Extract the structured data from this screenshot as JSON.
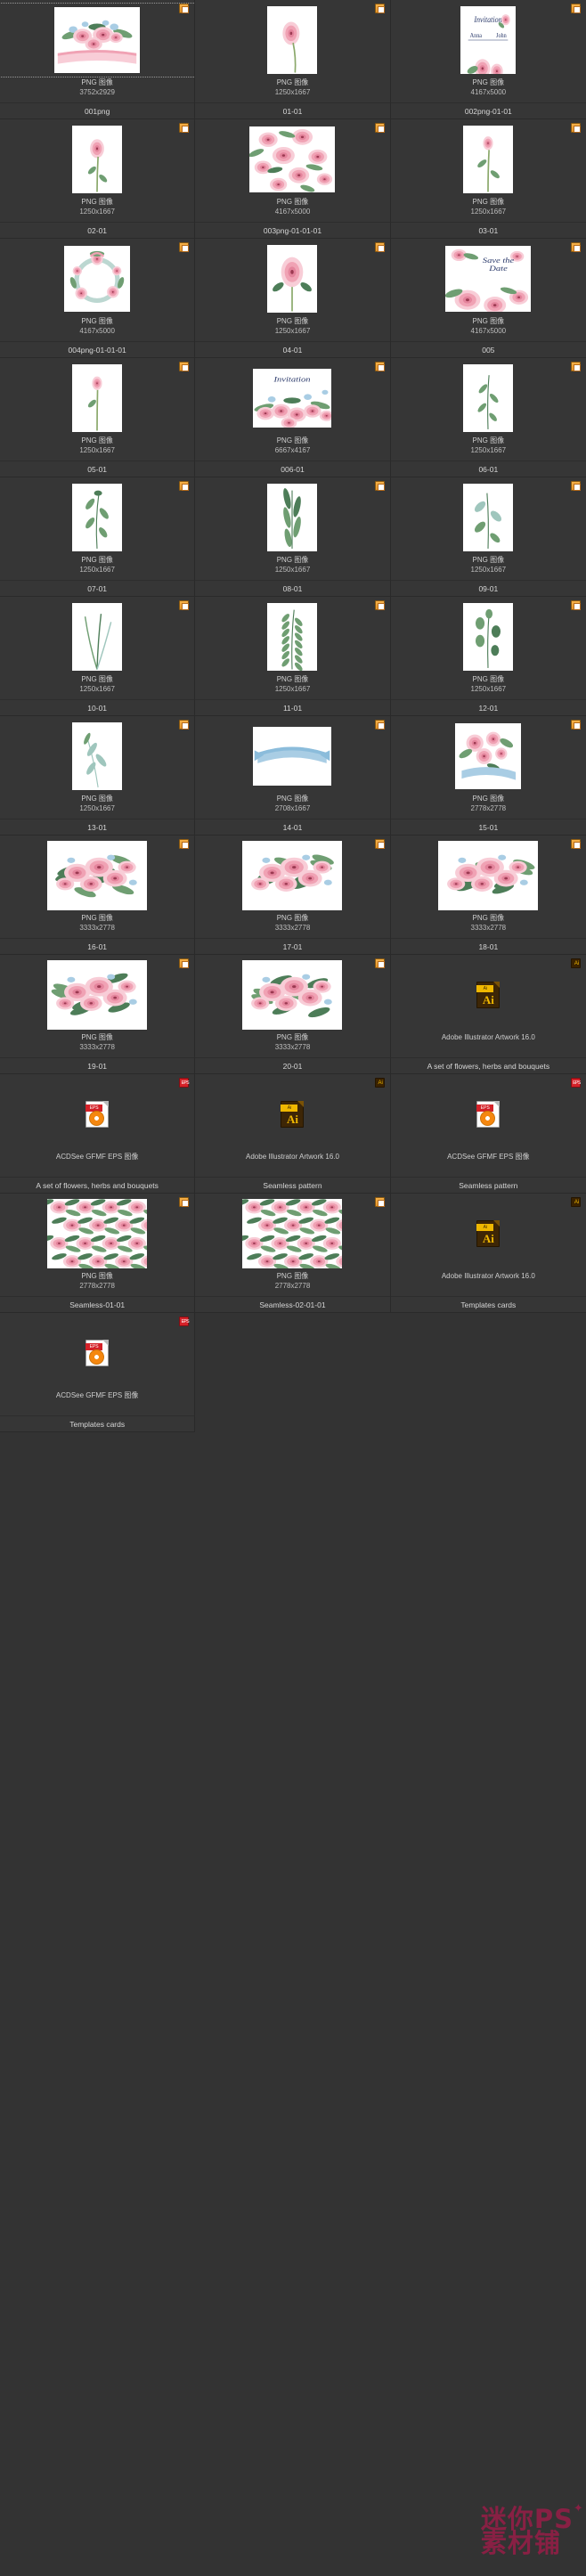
{
  "window": {
    "background": "#333333",
    "watermark_line1": "迷你PS",
    "watermark_line2": "素材铺",
    "watermark_color": "#8d1f45"
  },
  "labels": {
    "type_png": "PNG 图像",
    "type_ai": "Adobe Illustrator Artwork 16.0",
    "type_eps": "ACDSee GFMF EPS 图像"
  },
  "items": [
    {
      "badge": "png",
      "type": "PNG 图像",
      "dims": "3752x2929",
      "name": "001png",
      "art": "bouquet-ribbon",
      "shape": "sq-l",
      "selected": true
    },
    {
      "badge": "png",
      "type": "PNG 图像",
      "dims": "1250x1667",
      "name": "01-01",
      "art": "single-rose",
      "shape": "port",
      "selected": false
    },
    {
      "badge": "png",
      "type": "PNG 图像",
      "dims": "4167x5000",
      "name": "002png-01-01",
      "art": "invitation-card",
      "shape": "port-wide",
      "selected": false
    },
    {
      "badge": "png",
      "type": "PNG 图像",
      "dims": "1250x1667",
      "name": "02-01",
      "art": "rose-stem",
      "shape": "port",
      "selected": false
    },
    {
      "badge": "png",
      "type": "PNG 图像",
      "dims": "4167x5000",
      "name": "003png-01-01-01",
      "art": "rose-pattern",
      "shape": "sq-l",
      "selected": false
    },
    {
      "badge": "png",
      "type": "PNG 图像",
      "dims": "1250x1667",
      "name": "03-01",
      "art": "rose-bud-stem",
      "shape": "port",
      "selected": false
    },
    {
      "badge": "png",
      "type": "PNG 图像",
      "dims": "4167x5000",
      "name": "004png-01-01-01",
      "art": "floral-wreath",
      "shape": "sq",
      "selected": false
    },
    {
      "badge": "png",
      "type": "PNG 图像",
      "dims": "1250x1667",
      "name": "04-01",
      "art": "peony-open",
      "shape": "port",
      "selected": false
    },
    {
      "badge": "png",
      "type": "PNG 图像",
      "dims": "4167x5000",
      "name": "005",
      "art": "save-the-date",
      "shape": "sq-l",
      "selected": false
    },
    {
      "badge": "png",
      "type": "PNG 图像",
      "dims": "1250x1667",
      "name": "05-01",
      "art": "single-bud",
      "shape": "port",
      "selected": false
    },
    {
      "badge": "png",
      "type": "PNG 图像",
      "dims": "6667x4167",
      "name": "006-01",
      "art": "banner-flowers",
      "shape": "land",
      "selected": false
    },
    {
      "badge": "png",
      "type": "PNG 图像",
      "dims": "1250x1667",
      "name": "06-01",
      "art": "leaf-sprig",
      "shape": "port",
      "selected": false
    },
    {
      "badge": "png",
      "type": "PNG 图像",
      "dims": "1250x1667",
      "name": "07-01",
      "art": "leaf-branch-a",
      "shape": "port",
      "selected": false
    },
    {
      "badge": "png",
      "type": "PNG 图像",
      "dims": "1250x1667",
      "name": "08-01",
      "art": "leaf-branch-b",
      "shape": "port",
      "selected": false
    },
    {
      "badge": "png",
      "type": "PNG 图像",
      "dims": "1250x1667",
      "name": "09-01",
      "art": "leaf-branch-c",
      "shape": "port",
      "selected": false
    },
    {
      "badge": "png",
      "type": "PNG 图像",
      "dims": "1250x1667",
      "name": "10-01",
      "art": "grass-sprig",
      "shape": "port",
      "selected": false
    },
    {
      "badge": "png",
      "type": "PNG 图像",
      "dims": "1250x1667",
      "name": "11-01",
      "art": "fern-frond",
      "shape": "port",
      "selected": false
    },
    {
      "badge": "png",
      "type": "PNG 图像",
      "dims": "1250x1667",
      "name": "12-01",
      "art": "eucalyptus",
      "shape": "port",
      "selected": false
    },
    {
      "badge": "png",
      "type": "PNG 图像",
      "dims": "1250x1667",
      "name": "13-01",
      "art": "willow-leaves",
      "shape": "port",
      "selected": false
    },
    {
      "badge": "png",
      "type": "PNG 图像",
      "dims": "2708x1667",
      "name": "14-01",
      "art": "blue-ribbon",
      "shape": "land",
      "selected": false
    },
    {
      "badge": "png",
      "type": "PNG 图像",
      "dims": "2778x2778",
      "name": "15-01",
      "art": "rose-ribbon-corner",
      "shape": "sq",
      "selected": false
    },
    {
      "badge": "png",
      "type": "PNG 图像",
      "dims": "3333x2778",
      "name": "16-01",
      "art": "bouquet-a",
      "shape": "big",
      "selected": false
    },
    {
      "badge": "png",
      "type": "PNG 图像",
      "dims": "3333x2778",
      "name": "17-01",
      "art": "bouquet-b",
      "shape": "big",
      "selected": false
    },
    {
      "badge": "png",
      "type": "PNG 图像",
      "dims": "3333x2778",
      "name": "18-01",
      "art": "bouquet-c",
      "shape": "big",
      "selected": false
    },
    {
      "badge": "png",
      "type": "PNG 图像",
      "dims": "3333x2778",
      "name": "19-01",
      "art": "bouquet-d",
      "shape": "big",
      "selected": false
    },
    {
      "badge": "png",
      "type": "PNG 图像",
      "dims": "3333x2778",
      "name": "20-01",
      "art": "bouquet-e",
      "shape": "big",
      "selected": false
    },
    {
      "badge": "ai",
      "type": "Adobe Illustrator Artwork 16.0",
      "dims": "",
      "name": "A set of flowers, herbs and bouquets",
      "art": "ai-icon",
      "shape": "icon",
      "selected": false
    },
    {
      "badge": "eps",
      "type": "ACDSee GFMF EPS 图像",
      "dims": "",
      "name": "A set of flowers, herbs and bouquets",
      "art": "eps-icon",
      "shape": "icon",
      "selected": false
    },
    {
      "badge": "ai",
      "type": "Adobe Illustrator Artwork 16.0",
      "dims": "",
      "name": "Seamless pattern",
      "art": "ai-icon",
      "shape": "icon",
      "selected": false
    },
    {
      "badge": "eps",
      "type": "ACDSee GFMF EPS 图像",
      "dims": "",
      "name": "Seamless pattern",
      "art": "eps-icon",
      "shape": "icon",
      "selected": false
    },
    {
      "badge": "png",
      "type": "PNG 图像",
      "dims": "2778x2778",
      "name": "Seamless-01-01",
      "art": "seamless-a",
      "shape": "big",
      "selected": false
    },
    {
      "badge": "png",
      "type": "PNG 图像",
      "dims": "2778x2778",
      "name": "Seamless-02-01-01",
      "art": "seamless-b",
      "shape": "big",
      "selected": false
    },
    {
      "badge": "ai",
      "type": "Adobe Illustrator Artwork 16.0",
      "dims": "",
      "name": "Templates cards",
      "art": "ai-icon",
      "shape": "icon",
      "selected": false
    },
    {
      "badge": "eps",
      "type": "ACDSee GFMF EPS 图像",
      "dims": "",
      "name": "Templates cards",
      "art": "eps-icon",
      "shape": "icon",
      "selected": false
    }
  ]
}
